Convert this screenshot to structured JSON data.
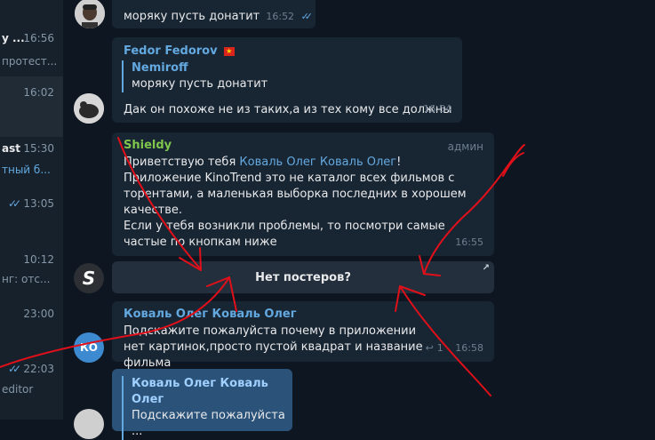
{
  "chat_list": {
    "items": [
      {
        "name": "y ...",
        "time": "16:56",
        "preview": "протест..."
      },
      {
        "time": "16:02"
      },
      {
        "name": "ast",
        "time": "15:30",
        "preview": "тный б..."
      },
      {
        "time": "13:05"
      },
      {
        "time": "10:12",
        "preview": "нг: отс..."
      },
      {
        "time": "23:00"
      },
      {
        "time": "22:03",
        "preview": "editor"
      }
    ]
  },
  "messages": {
    "m1": {
      "text": "моряку пусть донатит",
      "time": "16:52"
    },
    "m2": {
      "sender": "Fedor Fedorov",
      "reply_name": "Nemiroff",
      "reply_text": "моряку пусть донатит",
      "text": "Дак он похоже не из таких,а из тех кому все должны",
      "time": "16:54"
    },
    "m3": {
      "sender": "Shieldy",
      "role": "админ",
      "greeting": "Приветствую тебя ",
      "mention": "Коваль Олег Коваль Олег",
      "greeting_end": "!",
      "body1": "Приложение KinoTrend это не каталог всех фильмов с торентами, а маленькая выборка последних в хорошем качестве.",
      "body2": "Если у тебя возникли проблемы, то посмотри самые частые по кнопкам ниже",
      "time": "16:55",
      "button_label": "Нет постеров?"
    },
    "m4": {
      "sender": "Коваль Олег Коваль Олег",
      "avatar_initials": "КО",
      "text": "Подскажите  пожалуйста почему в приложении нет картинок,просто пустой квадрат и название фильма",
      "replies": "1",
      "time": "16:58"
    },
    "m5": {
      "reply_name": "Коваль Олег Коваль Олег",
      "reply_text": "Подскажите  пожалуйста ..."
    }
  },
  "colors": {
    "accent": "#63a9e0",
    "annotation": "#e0101a"
  }
}
